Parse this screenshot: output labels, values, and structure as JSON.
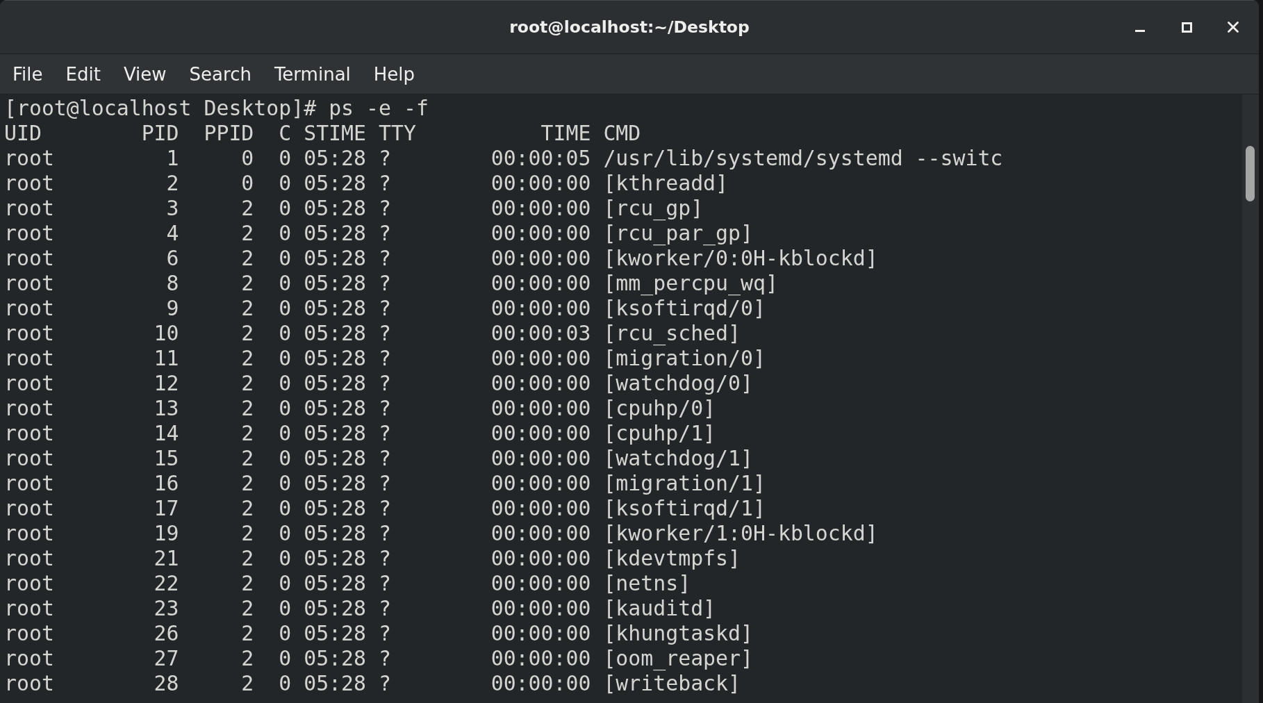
{
  "window": {
    "title": "root@localhost:~/Desktop"
  },
  "menu_bar": [
    "File",
    "Edit",
    "View",
    "Search",
    "Terminal",
    "Help"
  ],
  "terminal": {
    "prompt": "[root@localhost Desktop]#",
    "command": "ps -e -f",
    "table": {
      "columns": [
        "UID",
        "PID",
        "PPID",
        "C",
        "STIME",
        "TTY",
        "TIME",
        "CMD"
      ],
      "rows": [
        [
          "root",
          "1",
          "0",
          "0",
          "05:28",
          "?",
          "00:00:05",
          "/usr/lib/systemd/systemd --switc"
        ],
        [
          "root",
          "2",
          "0",
          "0",
          "05:28",
          "?",
          "00:00:00",
          "[kthreadd]"
        ],
        [
          "root",
          "3",
          "2",
          "0",
          "05:28",
          "?",
          "00:00:00",
          "[rcu_gp]"
        ],
        [
          "root",
          "4",
          "2",
          "0",
          "05:28",
          "?",
          "00:00:00",
          "[rcu_par_gp]"
        ],
        [
          "root",
          "6",
          "2",
          "0",
          "05:28",
          "?",
          "00:00:00",
          "[kworker/0:0H-kblockd]"
        ],
        [
          "root",
          "8",
          "2",
          "0",
          "05:28",
          "?",
          "00:00:00",
          "[mm_percpu_wq]"
        ],
        [
          "root",
          "9",
          "2",
          "0",
          "05:28",
          "?",
          "00:00:00",
          "[ksoftirqd/0]"
        ],
        [
          "root",
          "10",
          "2",
          "0",
          "05:28",
          "?",
          "00:00:03",
          "[rcu_sched]"
        ],
        [
          "root",
          "11",
          "2",
          "0",
          "05:28",
          "?",
          "00:00:00",
          "[migration/0]"
        ],
        [
          "root",
          "12",
          "2",
          "0",
          "05:28",
          "?",
          "00:00:00",
          "[watchdog/0]"
        ],
        [
          "root",
          "13",
          "2",
          "0",
          "05:28",
          "?",
          "00:00:00",
          "[cpuhp/0]"
        ],
        [
          "root",
          "14",
          "2",
          "0",
          "05:28",
          "?",
          "00:00:00",
          "[cpuhp/1]"
        ],
        [
          "root",
          "15",
          "2",
          "0",
          "05:28",
          "?",
          "00:00:00",
          "[watchdog/1]"
        ],
        [
          "root",
          "16",
          "2",
          "0",
          "05:28",
          "?",
          "00:00:00",
          "[migration/1]"
        ],
        [
          "root",
          "17",
          "2",
          "0",
          "05:28",
          "?",
          "00:00:00",
          "[ksoftirqd/1]"
        ],
        [
          "root",
          "19",
          "2",
          "0",
          "05:28",
          "?",
          "00:00:00",
          "[kworker/1:0H-kblockd]"
        ],
        [
          "root",
          "21",
          "2",
          "0",
          "05:28",
          "?",
          "00:00:00",
          "[kdevtmpfs]"
        ],
        [
          "root",
          "22",
          "2",
          "0",
          "05:28",
          "?",
          "00:00:00",
          "[netns]"
        ],
        [
          "root",
          "23",
          "2",
          "0",
          "05:28",
          "?",
          "00:00:00",
          "[kauditd]"
        ],
        [
          "root",
          "26",
          "2",
          "0",
          "05:28",
          "?",
          "00:00:00",
          "[khungtaskd]"
        ],
        [
          "root",
          "27",
          "2",
          "0",
          "05:28",
          "?",
          "00:00:00",
          "[oom_reaper]"
        ],
        [
          "root",
          "28",
          "2",
          "0",
          "05:28",
          "?",
          "00:00:00",
          "[writeback]"
        ]
      ]
    }
  }
}
